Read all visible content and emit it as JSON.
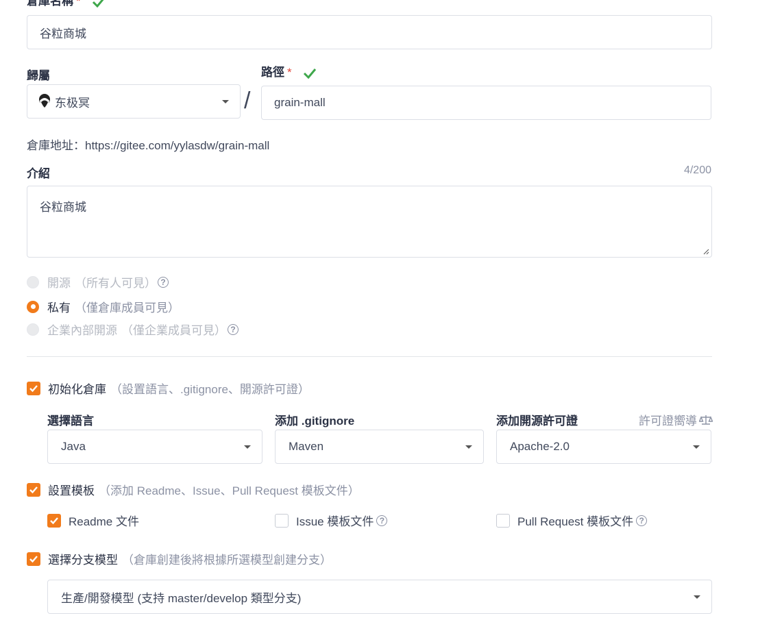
{
  "repo_name": {
    "label": "倉庫名稱",
    "required_mark": "*",
    "value": "谷粒商城"
  },
  "owner": {
    "label": "歸屬",
    "value": "东极冥"
  },
  "separator": "/",
  "path": {
    "label": "路徑",
    "required_mark": "*",
    "value": "grain-mall"
  },
  "repo_address": "倉庫地址：https://gitee.com/yylasdw/grain-mall",
  "intro": {
    "label": "介紹",
    "counter": "4/200",
    "value": "谷粒商城"
  },
  "visibility": {
    "options": [
      {
        "label": "開源",
        "hint": "（所有人可見）",
        "state": "disabled",
        "help": true
      },
      {
        "label": "私有",
        "hint": "（僅倉庫成員可見）",
        "state": "checked",
        "help": false
      },
      {
        "label": "企業內部開源",
        "hint": "（僅企業成員可見）",
        "state": "disabled",
        "help": true
      }
    ]
  },
  "init_repo": {
    "label": "初始化倉庫",
    "hint": "（設置語言、.gitignore、開源許可證）",
    "checked": true,
    "language": {
      "label": "選擇語言",
      "value": "Java"
    },
    "gitignore": {
      "label": "添加 .gitignore",
      "value": "Maven"
    },
    "license": {
      "label": "添加開源許可證",
      "guide": "許可證嚮導",
      "value": "Apache-2.0"
    }
  },
  "template": {
    "label": "設置模板",
    "hint": "（添加 Readme、Issue、Pull Request 模板文件）",
    "checked": true,
    "readme": {
      "label": "Readme 文件",
      "checked": true
    },
    "issue": {
      "label": "Issue 模板文件",
      "checked": false
    },
    "pr": {
      "label": "Pull Request 模板文件",
      "checked": false
    }
  },
  "branch": {
    "label": "選擇分支模型",
    "hint": "（倉庫創建後將根據所選模型創建分支）",
    "checked": true,
    "value": "生產/開發模型 (支持 master/develop 類型分支)"
  },
  "colors": {
    "accent": "#f17b1b",
    "success": "#3ea74b",
    "required": "#e0453a"
  }
}
